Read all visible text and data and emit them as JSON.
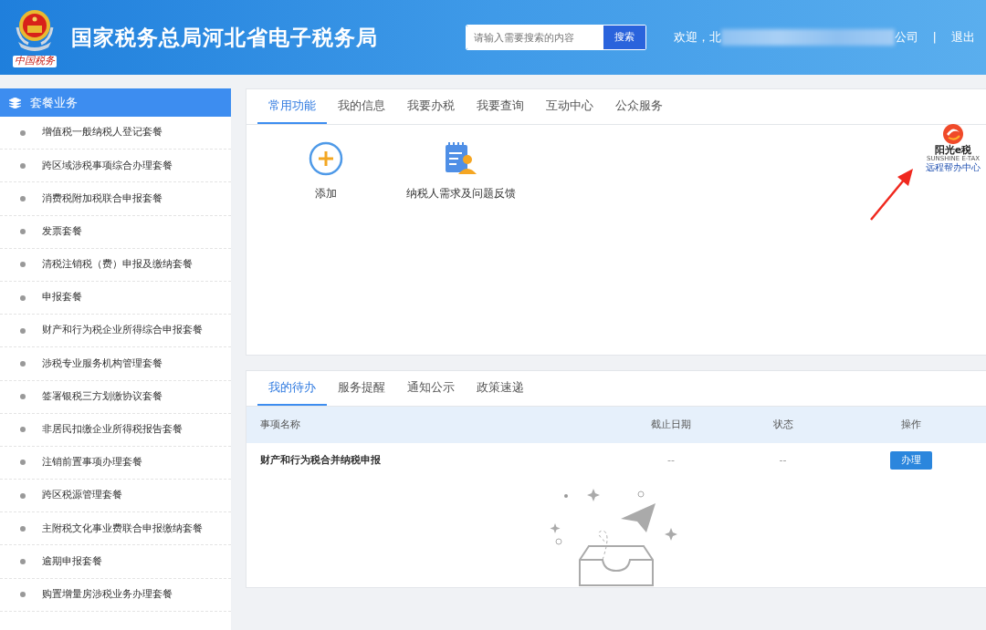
{
  "header": {
    "title": "国家税务总局河北省电子税务局",
    "emblem_caption": "中国税务",
    "search": {
      "placeholder": "请输入需要搜索的内容",
      "button": "搜索"
    },
    "welcome_start": "欢迎，北",
    "welcome_end": "公司",
    "separator": "|",
    "logout": "退出"
  },
  "sidebar": {
    "title": "套餐业务",
    "items": [
      {
        "label": "增值税一般纳税人登记套餐"
      },
      {
        "label": "跨区域涉税事项综合办理套餐"
      },
      {
        "label": "消费税附加税联合申报套餐"
      },
      {
        "label": "发票套餐"
      },
      {
        "label": "清税注销税（费）申报及缴纳套餐"
      },
      {
        "label": "申报套餐"
      },
      {
        "label": "财产和行为税企业所得综合申报套餐"
      },
      {
        "label": "涉税专业服务机构管理套餐"
      },
      {
        "label": "签署银税三方划缴协议套餐"
      },
      {
        "label": "非居民扣缴企业所得税报告套餐"
      },
      {
        "label": "注销前置事项办理套餐"
      },
      {
        "label": "跨区税源管理套餐"
      },
      {
        "label": "主附税文化事业费联合申报缴纳套餐"
      },
      {
        "label": "逾期申报套餐"
      },
      {
        "label": "购置增量房涉税业务办理套餐"
      }
    ]
  },
  "function_tabs": [
    {
      "label": "常用功能",
      "selected": true
    },
    {
      "label": "我的信息",
      "selected": false
    },
    {
      "label": "我要办税",
      "selected": false
    },
    {
      "label": "我要查询",
      "selected": false
    },
    {
      "label": "互动中心",
      "selected": false
    },
    {
      "label": "公众服务",
      "selected": false
    }
  ],
  "shortcuts": [
    {
      "kind": "add",
      "label": "添加"
    },
    {
      "kind": "feedback",
      "label": "纳税人需求及问题反馈"
    }
  ],
  "remote_help": {
    "brand": "阳光e税",
    "brand_en": "SUNSHINE E-TAX",
    "caption": "远程帮办中心"
  },
  "todo_tabs": [
    {
      "label": "我的待办",
      "selected": true
    },
    {
      "label": "服务提醒",
      "selected": false
    },
    {
      "label": "通知公示",
      "selected": false
    },
    {
      "label": "政策速递",
      "selected": false
    }
  ],
  "todo_table": {
    "columns": [
      "事项名称",
      "截止日期",
      "状态",
      "操作"
    ],
    "rows": [
      {
        "name": "财产和行为税合并纳税申报",
        "deadline": "--",
        "status": "--",
        "action": "办理"
      }
    ]
  }
}
